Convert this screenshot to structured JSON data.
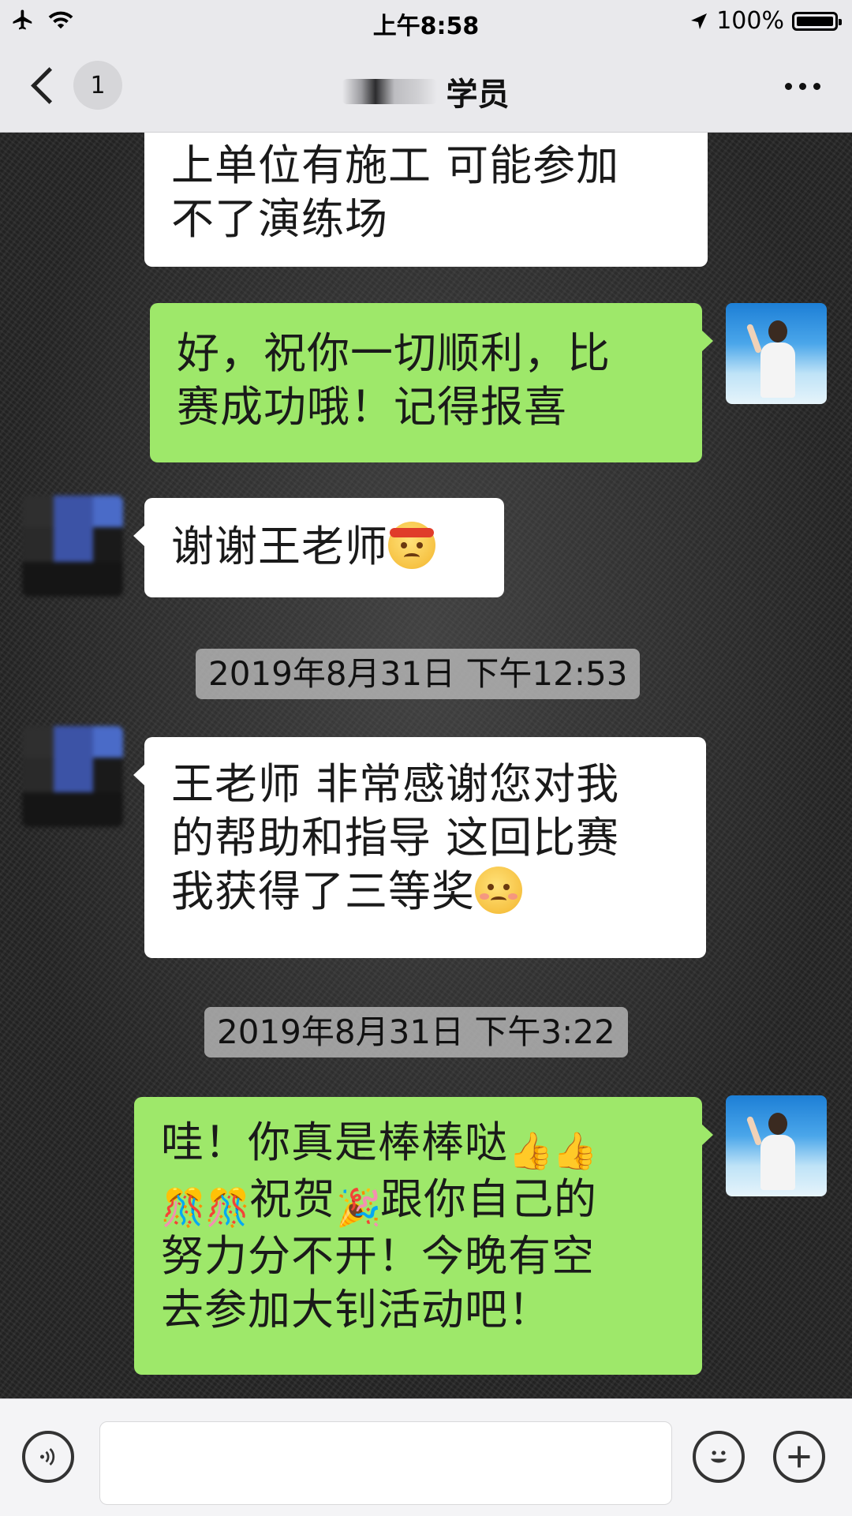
{
  "status_bar": {
    "time": "上午8:58",
    "battery": "100%",
    "icons": [
      "airplane-icon",
      "wifi-icon",
      "location-arrow-icon",
      "battery-icon"
    ]
  },
  "nav": {
    "back_badge": "1",
    "title": "学员",
    "icons": [
      "back-chevron-icon",
      "more-icon"
    ]
  },
  "messages": [
    {
      "side": "left",
      "lines": [
        "上单位有施工 可能参加",
        "不了演练场"
      ]
    },
    {
      "side": "right",
      "lines": [
        "好，祝你一切顺利，比",
        "赛成功哦！记得报喜"
      ]
    },
    {
      "side": "left",
      "text": "谢谢王老师",
      "emoji": "determined-face-headband-emoji"
    },
    {
      "type": "timestamp",
      "text": "2019年8月31日 下午12:53"
    },
    {
      "side": "left",
      "lines": [
        "王老师 非常感谢您对我",
        "的帮助和指导 这回比赛",
        "我获得了三等奖"
      ],
      "emoji": "smiling-face-emoji"
    },
    {
      "type": "timestamp",
      "text": "2019年8月31日 下午3:22"
    },
    {
      "side": "right",
      "line1": "哇！你真是棒棒哒",
      "line2": "祝贺",
      "line2b": "跟你自己的",
      "lines_rest": [
        "努力分不开！今晚有空",
        "去参加大钊活动吧！"
      ],
      "emojis": [
        "thumbs-up-emoji",
        "confetti-ball-emoji",
        "party-popper-emoji"
      ]
    }
  ],
  "input_bar": {
    "icons": [
      "voice-icon",
      "emoji-icon",
      "plus-icon"
    ]
  }
}
